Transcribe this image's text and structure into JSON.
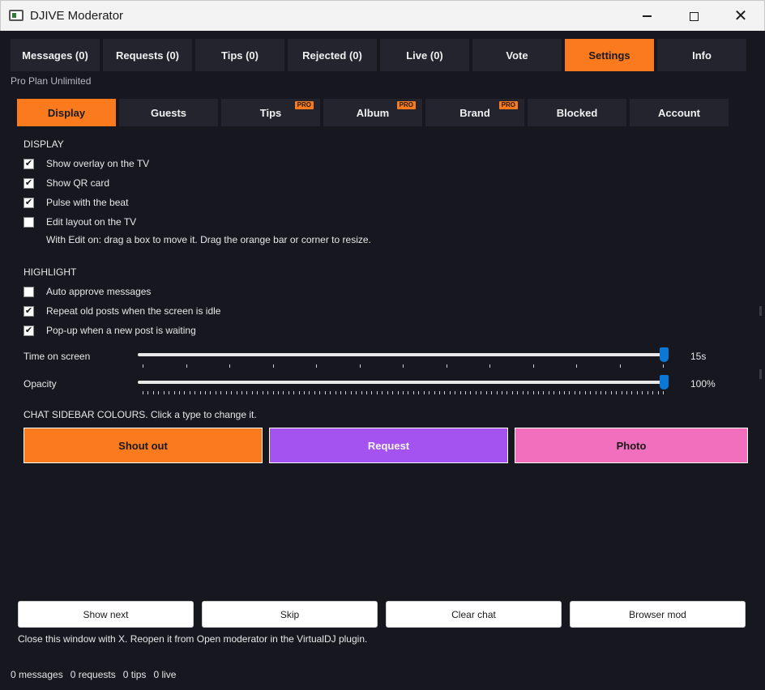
{
  "window": {
    "title": "DJIVE Moderator"
  },
  "top_tabs": [
    {
      "label": "Messages (0)"
    },
    {
      "label": "Requests (0)"
    },
    {
      "label": "Tips (0)"
    },
    {
      "label": "Rejected (0)"
    },
    {
      "label": "Live (0)"
    },
    {
      "label": "Vote"
    },
    {
      "label": "Settings",
      "active": true
    },
    {
      "label": "Info"
    }
  ],
  "plan": "Pro Plan Unlimited",
  "sub_tabs": [
    {
      "label": "Display",
      "active": true
    },
    {
      "label": "Guests"
    },
    {
      "label": "Tips",
      "badge": "PRO"
    },
    {
      "label": "Album",
      "badge": "PRO"
    },
    {
      "label": "Brand",
      "badge": "PRO"
    },
    {
      "label": "Blocked"
    },
    {
      "label": "Account"
    }
  ],
  "display": {
    "title": "DISPLAY",
    "options": [
      {
        "label": "Show overlay on the TV",
        "checked": true
      },
      {
        "label": "Show QR card",
        "checked": true
      },
      {
        "label": "Pulse with the beat",
        "checked": true
      },
      {
        "label": "Edit layout on the TV",
        "checked": false
      }
    ],
    "hint": "With Edit on: drag a box to move it. Drag the orange bar or corner to resize."
  },
  "highlight": {
    "title": "HIGHLIGHT",
    "options": [
      {
        "label": "Auto approve messages",
        "checked": false
      },
      {
        "label": "Repeat old posts when the screen is idle",
        "checked": true
      },
      {
        "label": "Pop-up when a new post is waiting",
        "checked": true
      }
    ]
  },
  "sliders": [
    {
      "label": "Time on screen",
      "value_text": "15s",
      "fraction": 1.0,
      "tick_count": 13
    },
    {
      "label": "Opacity",
      "value_text": "100%",
      "fraction": 1.0,
      "tick_count": 101
    }
  ],
  "chat_colours": {
    "title": "CHAT SIDEBAR COLOURS. Click a type to change it.",
    "types": [
      {
        "label": "Shout out",
        "color": "#fb7a1e"
      },
      {
        "label": "Request",
        "color": "#a452f0"
      },
      {
        "label": "Photo",
        "color": "#f26fbd"
      }
    ]
  },
  "actions": [
    {
      "label": "Show next"
    },
    {
      "label": "Skip"
    },
    {
      "label": "Clear chat"
    },
    {
      "label": "Browser mod"
    }
  ],
  "footnote": "Close this window with X. Reopen it from Open moderator in the VirtualDJ plugin.",
  "status": {
    "messages": "0 messages",
    "requests": "0 requests",
    "tips": "0 tips",
    "live": "0 live"
  },
  "colors": {
    "accent": "#fb7a1e",
    "background": "#16171f",
    "tab_bg": "#23242e",
    "slider_thumb": "#0a78d7"
  }
}
